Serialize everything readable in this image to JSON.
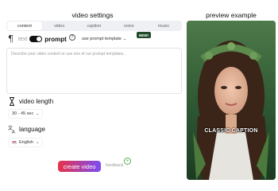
{
  "left": {
    "title": "video settings",
    "tabs": [
      "content",
      "video",
      "caption",
      "voice",
      "music"
    ],
    "active_tab": "content",
    "prompt_row": {
      "text_label": "text",
      "prompt_label": "prompt",
      "toggle_on": true,
      "template_select": "use prompt template",
      "new_badge": "NEW!"
    },
    "prompt_placeholder": "Describe your video content or use one of our prompt templates...",
    "video_length": {
      "label": "video length",
      "value": "30 - 45 sec"
    },
    "language": {
      "label": "language",
      "value": "English"
    },
    "create_button": "create video",
    "feedback_label": "feedback"
  },
  "right": {
    "title": "preview example",
    "caption": "CLASSIC CAPTION"
  },
  "colors": {
    "create_gradient_start": "#e8324a",
    "create_gradient_end": "#7b4cf2",
    "new_badge_bg": "#1e4a2a",
    "toggle_bg": "#111111",
    "feedback_icon": "#4caf50"
  },
  "icons": [
    "pilcrow-icon",
    "help-circle-icon",
    "hourglass-icon",
    "translate-icon",
    "flag-icon",
    "chevron-down-icon",
    "feedback-plus-icon"
  ]
}
